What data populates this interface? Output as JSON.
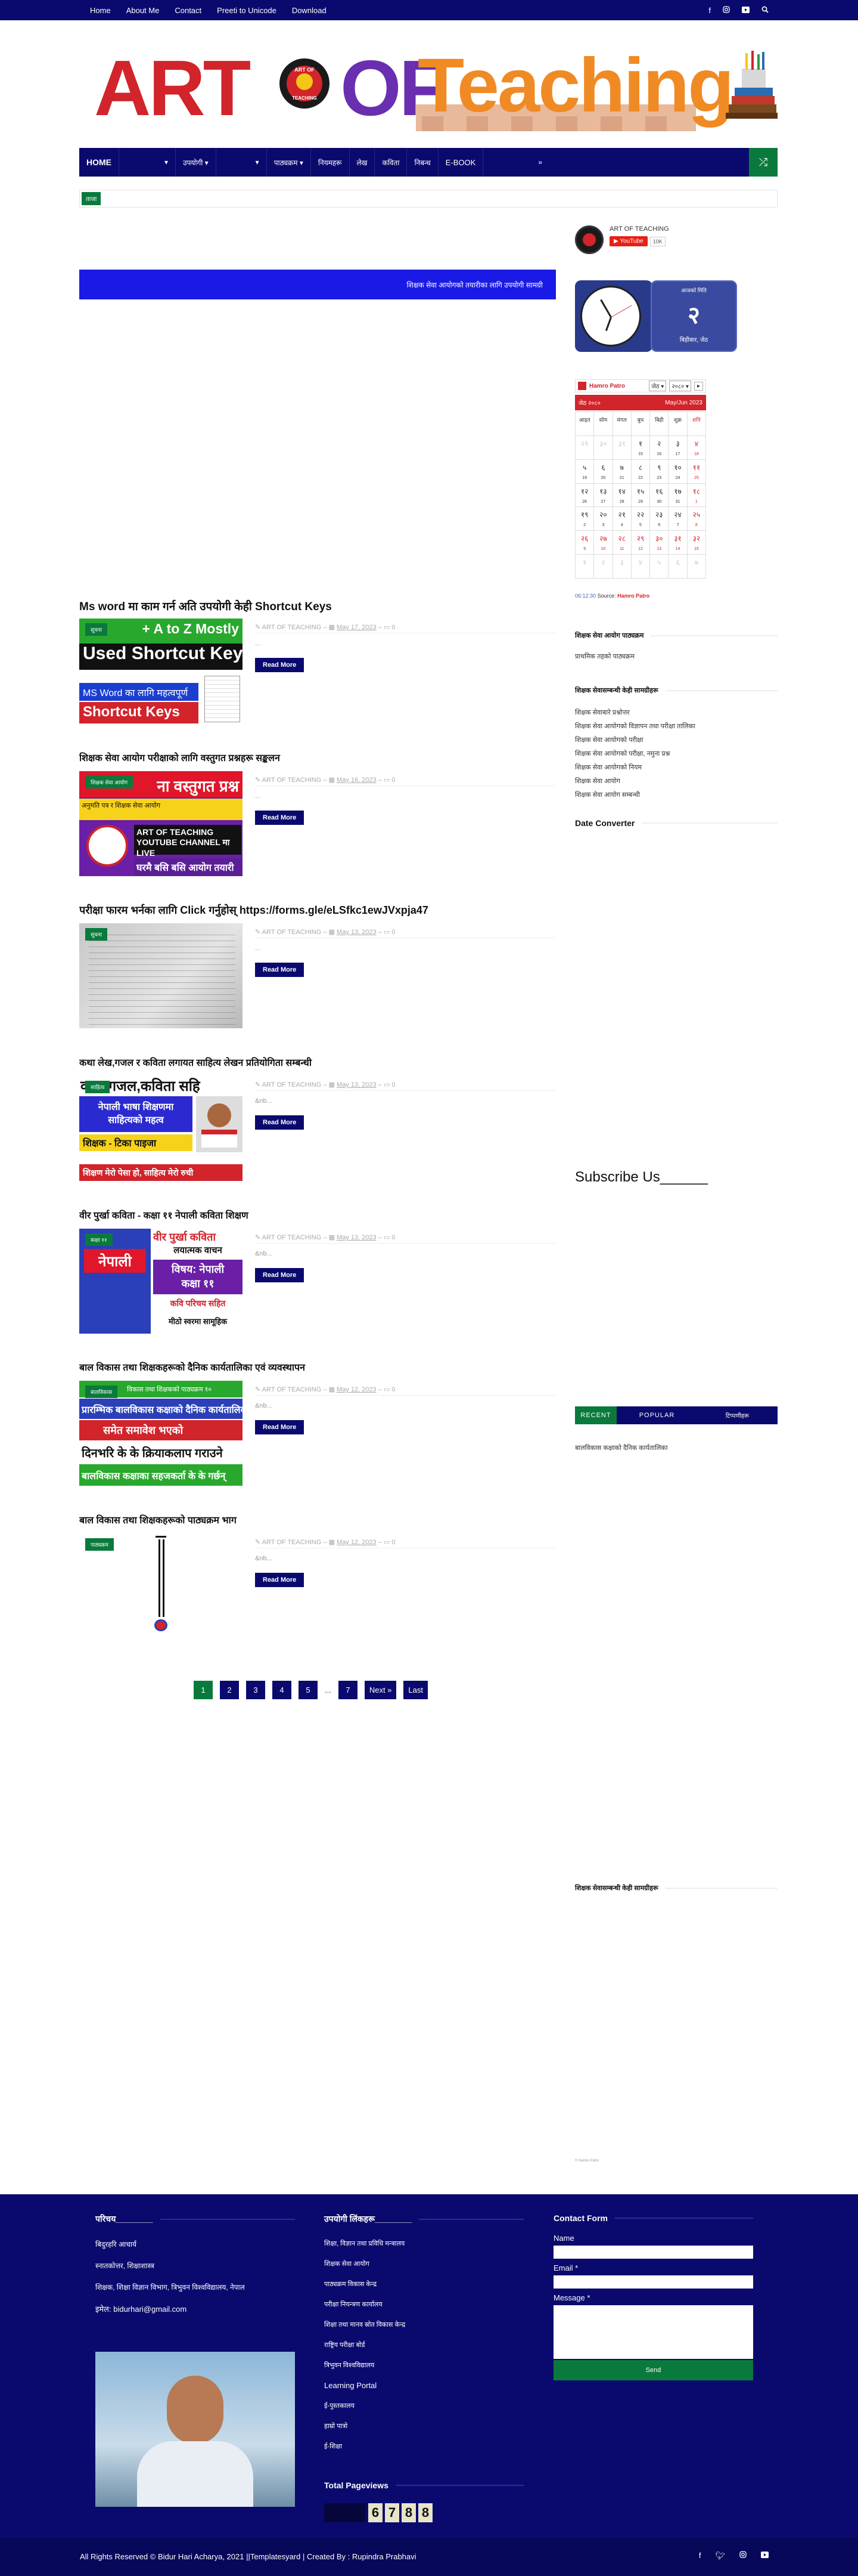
{
  "topnav": {
    "items": [
      "Home",
      "About Me",
      "Contact",
      "Preeti to Unicode",
      "Download"
    ]
  },
  "topicons": [
    "facebook-icon",
    "instagram-icon",
    "youtube-icon",
    "search-icon"
  ],
  "logo": {
    "word1": "ART",
    "word2": "OF",
    "word3": "Teaching",
    "emblem_top": "ART OF",
    "emblem_bottom": "TEACHING"
  },
  "mainnav": {
    "items": [
      "HOME",
      "▾",
      "उपयोगी ▾",
      "▾",
      "पाठ्यक्रम ▾",
      "नियमहरू",
      "लेख",
      "कविता",
      "निबन्ध",
      "E-BOOK"
    ],
    "more": "»"
  },
  "ticker": {
    "tag": "ताजा"
  },
  "banner": {
    "text": "शिक्षक सेवा आयोगको तयारीका लागि उपयोगी सामग्री"
  },
  "posts": [
    {
      "title": "Ms word मा काम गर्न अति उपयोगी केही Shortcut Keys",
      "author": "ART OF TEACHING",
      "date": "May 17, 2023",
      "comments": "0",
      "snippet": "...",
      "read_more": "Read More",
      "thumb_lines": [
        "+ A to Z Mostly",
        "Used Shortcut Keys",
        "MS Word का लागि महत्वपूर्ण",
        "Shortcut Keys"
      ],
      "badge": "सूचना"
    },
    {
      "title": "शिक्षक सेवा आयोग परीक्षाको लागि वस्तुगत प्रश्नहरू सङ्कलन",
      "author": "ART OF TEACHING",
      "date": "May 16, 2023",
      "comments": "0",
      "snippet": "...",
      "read_more": "Read More",
      "thumb_lines": [
        "ना वस्तुगत प्रश्न",
        "अनुमति पत्र र शिक्षक सेवा आयोग",
        "ART OF TEACHING YOUTUBE CHANNEL मा LIVE",
        "घरमै बसि बसि आयोग तयारी"
      ],
      "badge": "शिक्षक सेवा आयोग"
    },
    {
      "title": "परीक्षा फारम भर्नका लागि Click गर्नुहोस् https://forms.gle/eLSfkc1ewJVxpja47",
      "author": "ART OF TEACHING",
      "date": "May 13, 2023",
      "comments": "0",
      "snippet": "...",
      "read_more": "Read More",
      "thumb_lines": [],
      "badge": "सूचना"
    },
    {
      "title": "कथा लेख,गजल र कविता लगायत साहित्य लेखन प्रतियोगिता सम्बन्धी",
      "author": "ART OF TEACHING",
      "date": "May 13, 2023",
      "comments": "0",
      "snippet": "&nb...",
      "read_more": "Read More",
      "thumb_lines": [
        "कथा,गजल,कविता सहि",
        "नेपाली भाषा शिक्षणमा",
        "साहित्यको महत्व",
        "शिक्षक - टिका पाइजा",
        "शिक्षण मेरो पेसा हो, साहित्य मेरो रुची"
      ],
      "badge": "साहित्य"
    },
    {
      "title": "वीर पुर्खा कविता - कक्षा ११ नेपाली कविता शिक्षण",
      "author": "ART OF TEACHING",
      "date": "May 13, 2023",
      "comments": "0",
      "snippet": "&nb...",
      "read_more": "Read More",
      "thumb_lines": [
        "नेपाली",
        "वीर पुर्खा कविता",
        "लयात्मक वाचन",
        "विषय: नेपाली",
        "कक्षा ११",
        "कवि परिचय सहित",
        "मीठो स्वरमा सामूहिक"
      ],
      "badge": "कक्षा ११"
    },
    {
      "title": "बाल विकास तथा शिक्षकहरूको दैनिक कार्यतालिका एवं व्यवस्थापन",
      "author": "ART OF TEACHING",
      "date": "May 12, 2023",
      "comments": "0",
      "snippet": "&nb...",
      "read_more": "Read More",
      "thumb_lines": [
        "विकास तथा शिक्षकको पाठ्यक्रम १०",
        "प्रारम्भिक बालविकास कक्षाको दैनिक कार्यतालिका",
        "समेत समावेश भएको",
        "दिनभरि के के क्रियाकलाप गराउने",
        "बालविकास कक्षाका सहजकर्ता के के गर्छन्"
      ],
      "badge": "बालविकास"
    },
    {
      "title": "बाल विकास तथा शिक्षकहरूको पाठ्यक्रम भाग",
      "author": "ART OF TEACHING",
      "date": "May 12, 2023",
      "comments": "0",
      "snippet": "&nb...",
      "read_more": "Read More",
      "thumb_lines": [],
      "badge": "पाठ्यक्रम"
    }
  ],
  "pager": {
    "pages": [
      "1",
      "2",
      "3",
      "4",
      "5",
      "...",
      "7"
    ],
    "next": "Next »",
    "last": "Last"
  },
  "sidebar": {
    "profile_name": "ART OF TEACHING",
    "youtube_label": "YouTube",
    "youtube_count": "10K",
    "date_widget": {
      "label": "आजको मिति",
      "weekday": "बिहीबार, जेठ"
    },
    "calendar": {
      "brand": "Hamro Patro",
      "month_sel": "जेठ",
      "year_sel": "२०८०",
      "nav": "▸",
      "bs_label": "जेठ २०८०",
      "ad_label": "May/Jun 2023",
      "time": "06:12:30",
      "source_label": "Source:",
      "source": "Hamro Patro"
    },
    "w1_title": "शिक्षक सेवा आयोग पाठ्यक्रम",
    "w1_items": [
      "प्राथमिक तहको पाठ्यक्रम"
    ],
    "w2_title": "शिक्षक सेवासम्बन्धी केही सामग्रीहरू",
    "w2_items": [
      "शिक्षक सेवाबारे प्रश्नोत्तर",
      "शिक्षक सेवा आयोगको विज्ञापन तथा परीक्षा तालिका",
      "शिक्षक सेवा आयोगको परीक्षा",
      "शिक्षक सेवा आयोगको परीक्षा, नमुना प्रश्न",
      "शिक्षक सेवा आयोगको नियम",
      "शिक्षक सेवा आयोग",
      "शिक्षक सेवा आयोग सम्बन्धी"
    ],
    "date_converter": "Date Converter",
    "subscribe": "Subscribe Us______",
    "tabs": [
      "RECENT",
      "POPULAR",
      "टिप्पणीहरू"
    ],
    "tab_item": "बालविकास कक्षाको दैनिक कार्यतालिका",
    "w3_title": "शिक्षक सेवासम्बन्धी केही सामग्रीहरू",
    "small_note": "© Hamro Patro"
  },
  "footer": {
    "col1_title": "परिचय________",
    "col1_items": [
      "बिदुरहरि आचार्य",
      "स्नातकोत्तर, शिक्षाशास्त्र",
      "शिक्षक, शिक्षा विज्ञान विभाग, त्रिभुवन विश्वविद्यालय, नेपाल"
    ],
    "email_label": "इमेल:",
    "email": "bidurhari@gmail.com",
    "col2_title": "उपयोगी लिंकहरू________",
    "col2_items": [
      "शिक्षा, विज्ञान तथा प्रविधि मन्त्रालय",
      "शिक्षक सेवा आयोग",
      "पाठ्यक्रम विकास केन्द्र",
      "परीक्षा नियन्त्रण कार्यालय",
      "शिक्षा तथा मानव स्रोत विकास केन्द्र",
      "राष्ट्रिय परीक्षा बोर्ड",
      "त्रिभुवन विश्वविद्यालय",
      "Learning Portal",
      "ई-पुस्तकालय",
      "हाम्रो पात्रो",
      "ई-शिक्षा"
    ],
    "pageviews_title": "Total Pageviews",
    "pageviews": [
      "6",
      "7",
      "8",
      "8"
    ],
    "contact_title": "Contact Form",
    "name_label": "Name",
    "email_field_label": "Email",
    "required": "*",
    "message_label": "Message",
    "send": "Send"
  },
  "copyright": "All Rights Reserved © Bidur Hari Acharya, 2021 ||Templatesyard | Created By : Rupindra Prabhavi",
  "copy_icons": [
    "facebook-icon",
    "twitter-icon",
    "instagram-icon",
    "youtube-icon"
  ],
  "colors": {
    "navy": "#0a0a6e",
    "green": "#0a7a3c",
    "banner_blue": "#1a1ae6",
    "red": "#d1242b"
  }
}
